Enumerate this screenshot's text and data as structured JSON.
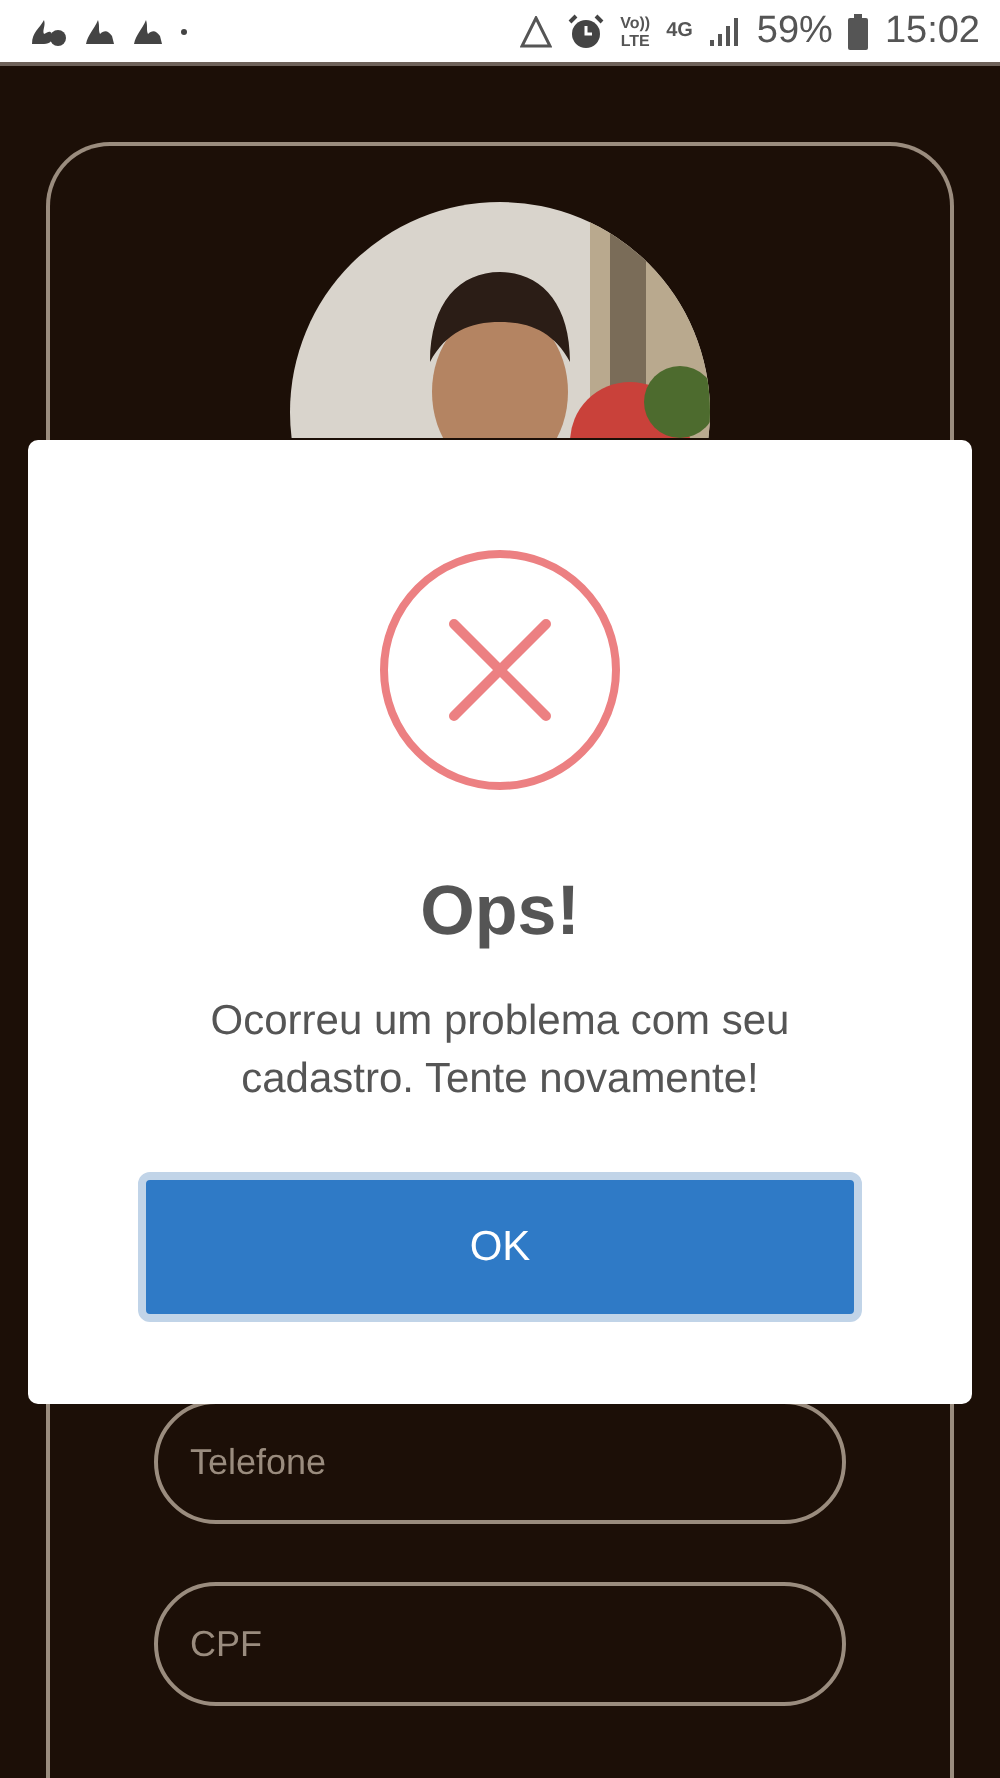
{
  "status_bar": {
    "volte": [
      "Vo))",
      "LTE"
    ],
    "network": "4G",
    "battery": "59%",
    "time": "15:02"
  },
  "fields": [
    {
      "placeholder": "Telefone"
    },
    {
      "placeholder": "CPF"
    }
  ],
  "dialog": {
    "kind": "error",
    "title": "Ops!",
    "message": "Ocorreu um problema com seu cadastro. Tente novamente!",
    "button": "OK"
  }
}
